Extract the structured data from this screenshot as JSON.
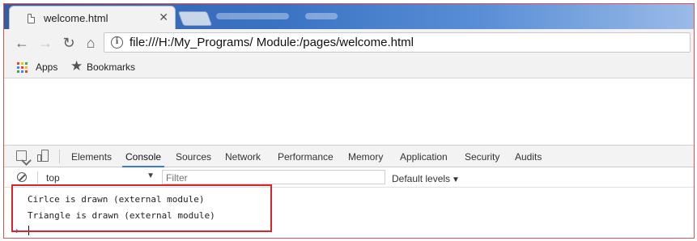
{
  "browser": {
    "tab": {
      "title": "welcome.html",
      "close": "✕"
    },
    "address": {
      "url": "file:///H:/My_Programs/ Module:/pages/welcome.html"
    },
    "nav": {
      "back": "←",
      "forward": "→",
      "reload": "↻",
      "home": "⌂"
    },
    "bookmarks": [
      {
        "label": "Apps",
        "icon": "apps-grid-icon"
      },
      {
        "label": "Bookmarks",
        "icon": "star-icon"
      }
    ]
  },
  "devtools": {
    "tabs": [
      "Elements",
      "Console",
      "Sources",
      "Network",
      "Performance",
      "Memory",
      "Application",
      "Security",
      "Audits"
    ],
    "active_tab": "Console",
    "toolbar": {
      "context": "top",
      "filter_placeholder": "Filter",
      "levels": "Default levels"
    },
    "console": {
      "lines": [
        "Cirlce is drawn (external module)",
        "Triangle is drawn (external module)"
      ],
      "prompt": "›"
    }
  },
  "colors": {
    "highlight": "#d9242a",
    "accent": "#3879d9",
    "apps_grid": [
      "#ea4335",
      "#fbbc05",
      "#34a853",
      "#4285f4"
    ]
  }
}
